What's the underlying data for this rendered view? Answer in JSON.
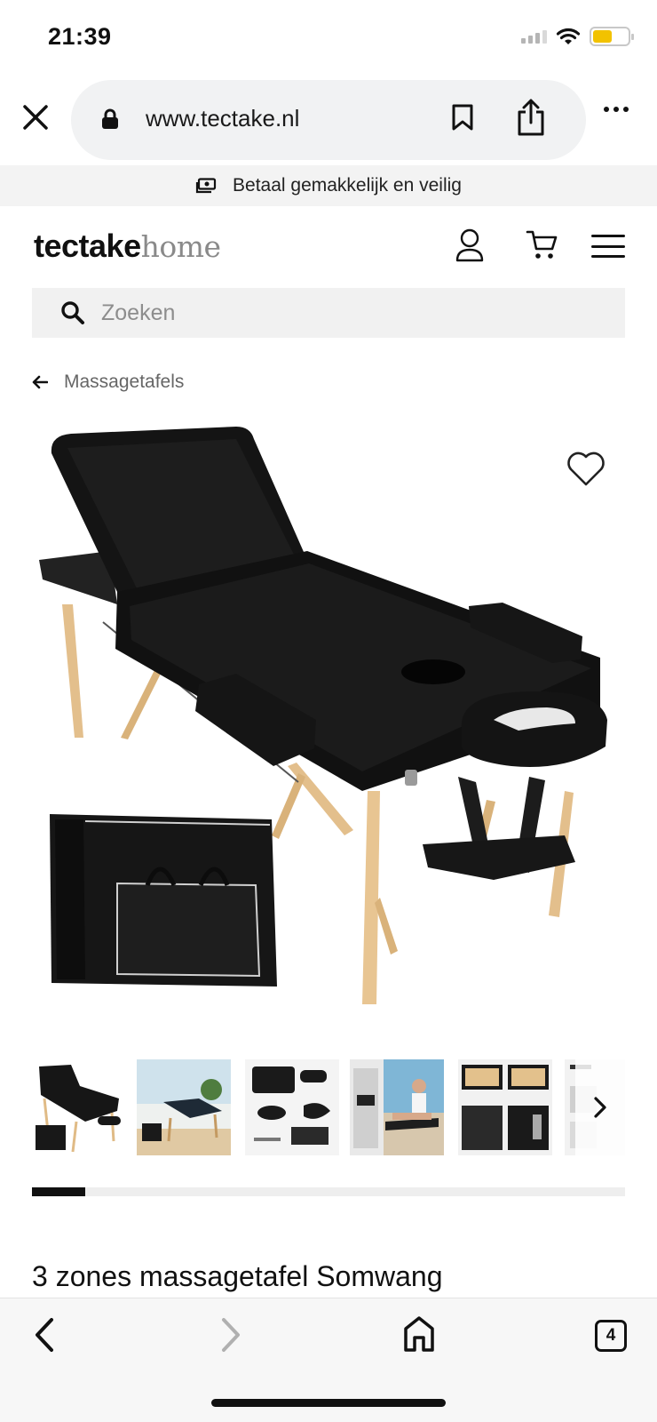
{
  "status_bar": {
    "time": "21:39",
    "battery_color": "#f2c200"
  },
  "browser": {
    "url": "www.tectake.nl",
    "icons": [
      "close-icon",
      "lock-icon",
      "bookmark-icon",
      "share-icon",
      "more-icon"
    ]
  },
  "banner": {
    "text": "Betaal gemakkelijk en veilig",
    "icon": "cash-icon"
  },
  "header": {
    "logo_bold": "tectake",
    "logo_light": "home",
    "icons": [
      "user-icon",
      "cart-icon",
      "menu-icon"
    ]
  },
  "search": {
    "placeholder": "Zoeken"
  },
  "breadcrumb": {
    "label": "Massagetafels"
  },
  "gallery": {
    "thumbnail_count": 6,
    "progress_fraction": 0.09
  },
  "product": {
    "title": "3 zones massagetafel Somwang"
  },
  "toolbar": {
    "tabs_count": "4"
  },
  "colors": {
    "accent": "#111111",
    "banner_bg": "#f3f3f3",
    "search_bg": "#f1f1f1",
    "wood": "#e6c08b"
  }
}
